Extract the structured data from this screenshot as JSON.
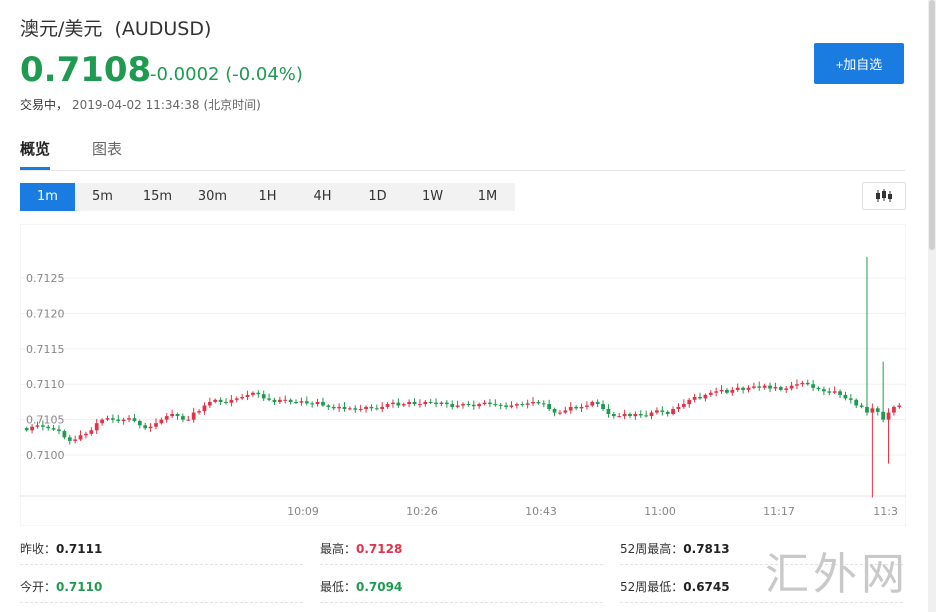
{
  "header": {
    "title": "澳元/美元",
    "symbol": "(AUDUSD)",
    "price": "0.7108",
    "change": "-0.0002 (-0.04%)",
    "status_label": "交易中，",
    "status_time": "2019-04-02 11:34:38",
    "status_tz": "(北京时间)",
    "add_watchlist_label": "+加自选"
  },
  "tabs": [
    {
      "label": "概览",
      "active": true
    },
    {
      "label": "图表",
      "active": false
    }
  ],
  "periods": [
    {
      "label": "1m",
      "active": true
    },
    {
      "label": "5m"
    },
    {
      "label": "15m"
    },
    {
      "label": "30m"
    },
    {
      "label": "1H"
    },
    {
      "label": "4H"
    },
    {
      "label": "1D"
    },
    {
      "label": "1W"
    },
    {
      "label": "1M"
    }
  ],
  "chart_type_icon": "candlestick-icon",
  "chart_data": {
    "type": "candlestick",
    "y_ticks": [
      "0.7125",
      "0.7120",
      "0.7115",
      "0.7110",
      "0.7105",
      "0.7100"
    ],
    "x_ticks": [
      "10:09",
      "10:26",
      "10:43",
      "11:00",
      "11:17",
      "11:3"
    ],
    "ylim": [
      0.70945,
      0.71315
    ],
    "up_color": "#e0334a",
    "down_color": "#1e9b50",
    "closes": [
      0.71035,
      0.7104,
      0.71042,
      0.7104,
      0.71038,
      0.71036,
      0.71034,
      0.71025,
      0.7102,
      0.71022,
      0.71028,
      0.7103,
      0.71035,
      0.71045,
      0.7105,
      0.71052,
      0.7105,
      0.71048,
      0.7105,
      0.71052,
      0.71048,
      0.71042,
      0.71038,
      0.7104,
      0.71045,
      0.7105,
      0.71055,
      0.71058,
      0.71055,
      0.7105,
      0.7105,
      0.7106,
      0.71062,
      0.7107,
      0.71075,
      0.71078,
      0.71075,
      0.71074,
      0.71078,
      0.7108,
      0.71082,
      0.71085,
      0.71088,
      0.71086,
      0.7108,
      0.71078,
      0.71075,
      0.71078,
      0.71078,
      0.71075,
      0.71074,
      0.71076,
      0.71073,
      0.71072,
      0.71075,
      0.7107,
      0.71068,
      0.71066,
      0.71068,
      0.71065,
      0.71066,
      0.71064,
      0.71065,
      0.71068,
      0.71066,
      0.71065,
      0.71068,
      0.71072,
      0.71074,
      0.7107,
      0.71072,
      0.71075,
      0.71072,
      0.71072,
      0.71075,
      0.71074,
      0.71072,
      0.71074,
      0.71072,
      0.71068,
      0.7107,
      0.71072,
      0.71071,
      0.71069,
      0.71072,
      0.71074,
      0.71072,
      0.71071,
      0.7107,
      0.71068,
      0.7107,
      0.71072,
      0.71071,
      0.71073,
      0.71075,
      0.71073,
      0.71072,
      0.71065,
      0.7106,
      0.7106,
      0.71063,
      0.71068,
      0.71066,
      0.71068,
      0.7107,
      0.71075,
      0.71072,
      0.71065,
      0.71058,
      0.71055,
      0.71055,
      0.71058,
      0.71055,
      0.71058,
      0.71056,
      0.71055,
      0.7106,
      0.71063,
      0.71061,
      0.71058,
      0.71065,
      0.71068,
      0.71072,
      0.71078,
      0.71082,
      0.7108,
      0.71085,
      0.71088,
      0.7109,
      0.71092,
      0.71088,
      0.71092,
      0.71095,
      0.71092,
      0.71095,
      0.71097,
      0.71095,
      0.71098,
      0.71094,
      0.71096,
      0.71092,
      0.71094,
      0.71098,
      0.711,
      0.71102,
      0.711,
      0.71095,
      0.71093,
      0.7109,
      0.71088,
      0.7109,
      0.71085,
      0.7108,
      0.71078,
      0.7107,
      0.71068,
      0.7106,
      0.71066,
      0.71061,
      0.7105,
      0.7106,
      0.71068,
      0.7107
    ]
  },
  "stats": [
    {
      "label": "昨收：",
      "value": "0.7111",
      "color": "dark"
    },
    {
      "label": "最高：",
      "value": "0.7128",
      "color": "red"
    },
    {
      "label": "52周最高：",
      "value": "0.7813",
      "color": "dark"
    },
    {
      "label": "今开：",
      "value": "0.7110",
      "color": "green"
    },
    {
      "label": "最低：",
      "value": "0.7094",
      "color": "green"
    },
    {
      "label": "52周最低：",
      "value": "0.6745",
      "color": "dark"
    }
  ],
  "watermark": "汇外网"
}
